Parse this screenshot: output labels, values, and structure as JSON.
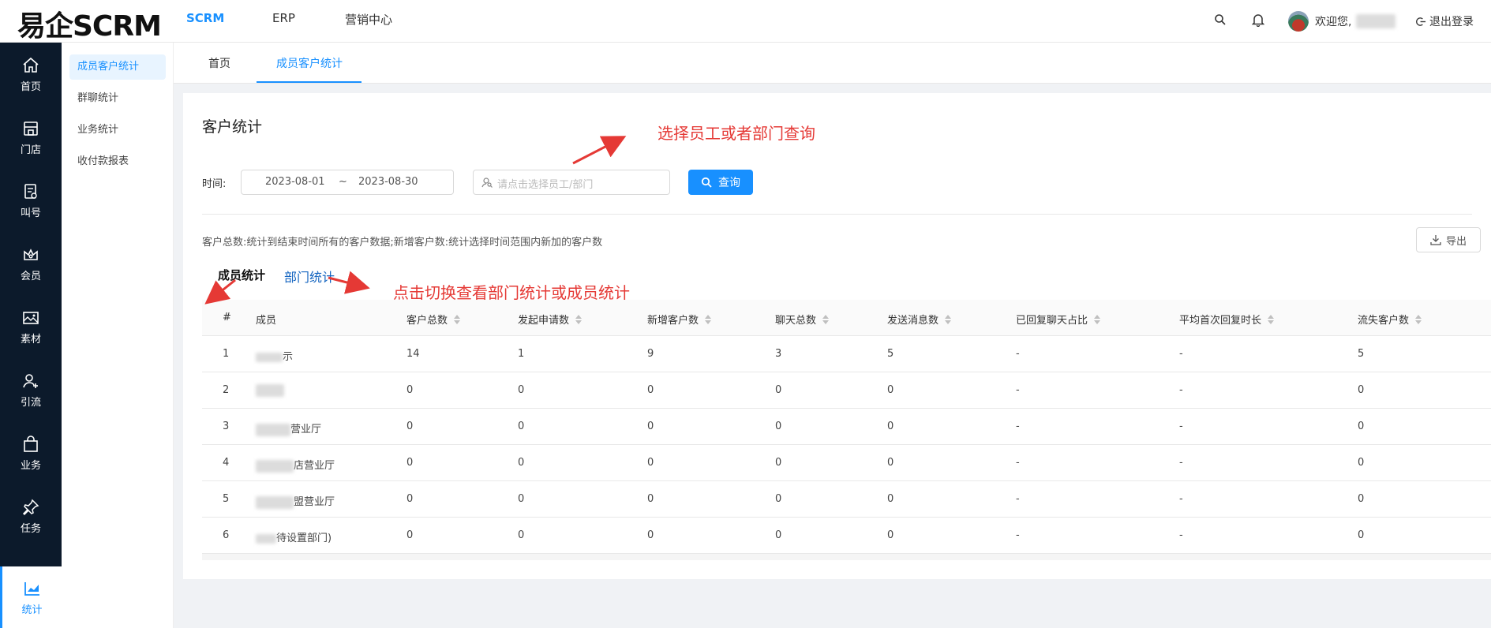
{
  "header": {
    "logo": "易企SCRM",
    "nav": [
      "SCRM",
      "ERP",
      "营销中心"
    ],
    "welcome": "欢迎您,",
    "logout": "退出登录"
  },
  "leftnav": {
    "items": [
      "首页",
      "门店",
      "叫号",
      "会员",
      "素材",
      "引流",
      "业务",
      "任务",
      "统计"
    ]
  },
  "subnav": {
    "items": [
      "成员客户统计",
      "群聊统计",
      "业务统计",
      "收付款报表"
    ]
  },
  "tabs": [
    "首页",
    "成员客户统计"
  ],
  "page": {
    "title": "客户统计",
    "time_label": "时间:",
    "date_start": "2023-08-01",
    "date_sep": "~",
    "date_end": "2023-08-30",
    "picker_placeholder": "请点击选择员工/部门",
    "query_label": "查询",
    "description": "客户总数:统计到结束时间所有的客户数据;新增客户数:统计选择时间范围内新加的客户数",
    "export_label": "导出",
    "switch_member": "成员统计",
    "switch_dept": "部门统计"
  },
  "table": {
    "columns": [
      "#",
      "成员",
      "客户总数",
      "发起申请数",
      "新增客户数",
      "聊天总数",
      "发送消息数",
      "已回复聊天占比",
      "平均首次回复时长",
      "流失客户数"
    ],
    "rows": [
      {
        "idx": "1",
        "member": "示",
        "total": "14",
        "apply": "1",
        "new": "9",
        "chat": "3",
        "msg": "5",
        "reply": "-",
        "avg": "-",
        "lost": "5"
      },
      {
        "idx": "2",
        "member": "",
        "total": "0",
        "apply": "0",
        "new": "0",
        "chat": "0",
        "msg": "0",
        "reply": "-",
        "avg": "-",
        "lost": "0"
      },
      {
        "idx": "3",
        "member": "营业厅",
        "total": "0",
        "apply": "0",
        "new": "0",
        "chat": "0",
        "msg": "0",
        "reply": "-",
        "avg": "-",
        "lost": "0"
      },
      {
        "idx": "4",
        "member": "店营业厅",
        "total": "0",
        "apply": "0",
        "new": "0",
        "chat": "0",
        "msg": "0",
        "reply": "-",
        "avg": "-",
        "lost": "0"
      },
      {
        "idx": "5",
        "member": "盟营业厅",
        "total": "0",
        "apply": "0",
        "new": "0",
        "chat": "0",
        "msg": "0",
        "reply": "-",
        "avg": "-",
        "lost": "0"
      },
      {
        "idx": "6",
        "member": "待设置部门)",
        "total": "0",
        "apply": "0",
        "new": "0",
        "chat": "0",
        "msg": "0",
        "reply": "-",
        "avg": "-",
        "lost": "0"
      }
    ]
  },
  "annotations": {
    "select": "选择员工或者部门查询",
    "switch": "点击切换查看部门统计或成员统计"
  },
  "colors": {
    "accent": "#1890ff",
    "sidebar": "#0c1a2b",
    "annotation": "#e53935"
  }
}
